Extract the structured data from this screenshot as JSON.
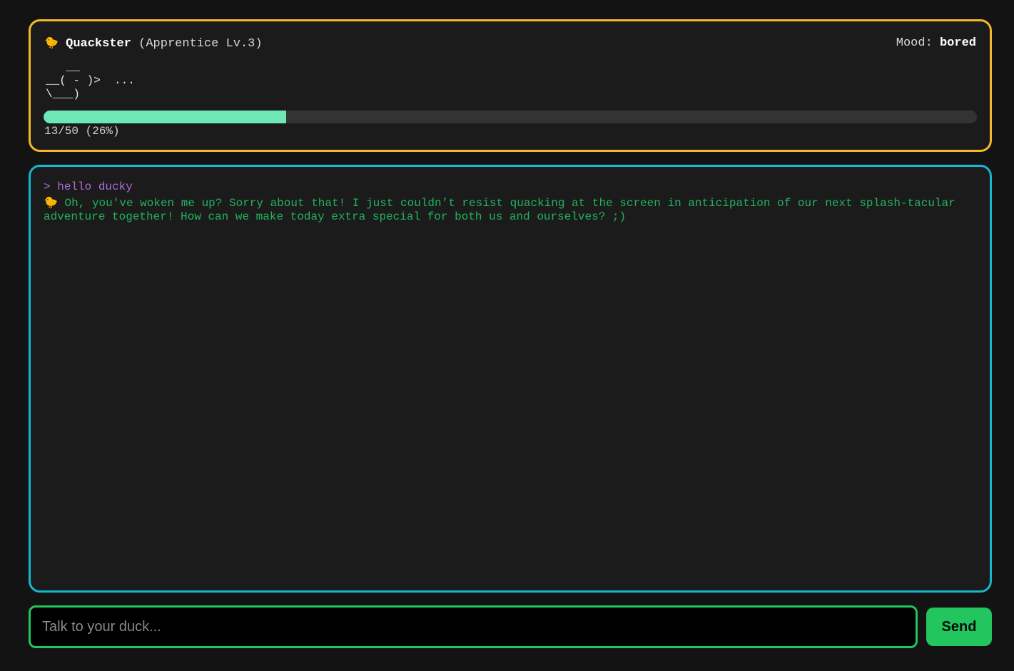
{
  "duck": {
    "emoji": "🐤",
    "name": "Quackster",
    "rank": "(Apprentice Lv.3)",
    "mood_label": "Mood:",
    "mood": "bored",
    "ascii": "   __\n__( - )>  ...\n\\___)"
  },
  "xp": {
    "current": 13,
    "max": 50,
    "percent": 26,
    "text": "13/50 (26%)",
    "bar_color": "#6ee7b7"
  },
  "chat": {
    "messages": [
      {
        "role": "user",
        "prefix": ">",
        "text": "hello ducky"
      },
      {
        "role": "duck",
        "prefix": "🐤",
        "text": "Oh, you've woken me up? Sorry about that! I just couldn’t resist quacking at the screen in anticipation of our next splash-tacular adventure together! How can we make today extra special for both us and ourselves? ;)"
      }
    ]
  },
  "input": {
    "placeholder": "Talk to your duck...",
    "value": ""
  },
  "send_label": "Send",
  "colors": {
    "status_border": "#f5b82a",
    "chat_border": "#16b6cf",
    "input_border": "#22c55e",
    "user_text": "#b06bd9",
    "duck_text": "#22b35e",
    "send_button": "#22c55e"
  }
}
